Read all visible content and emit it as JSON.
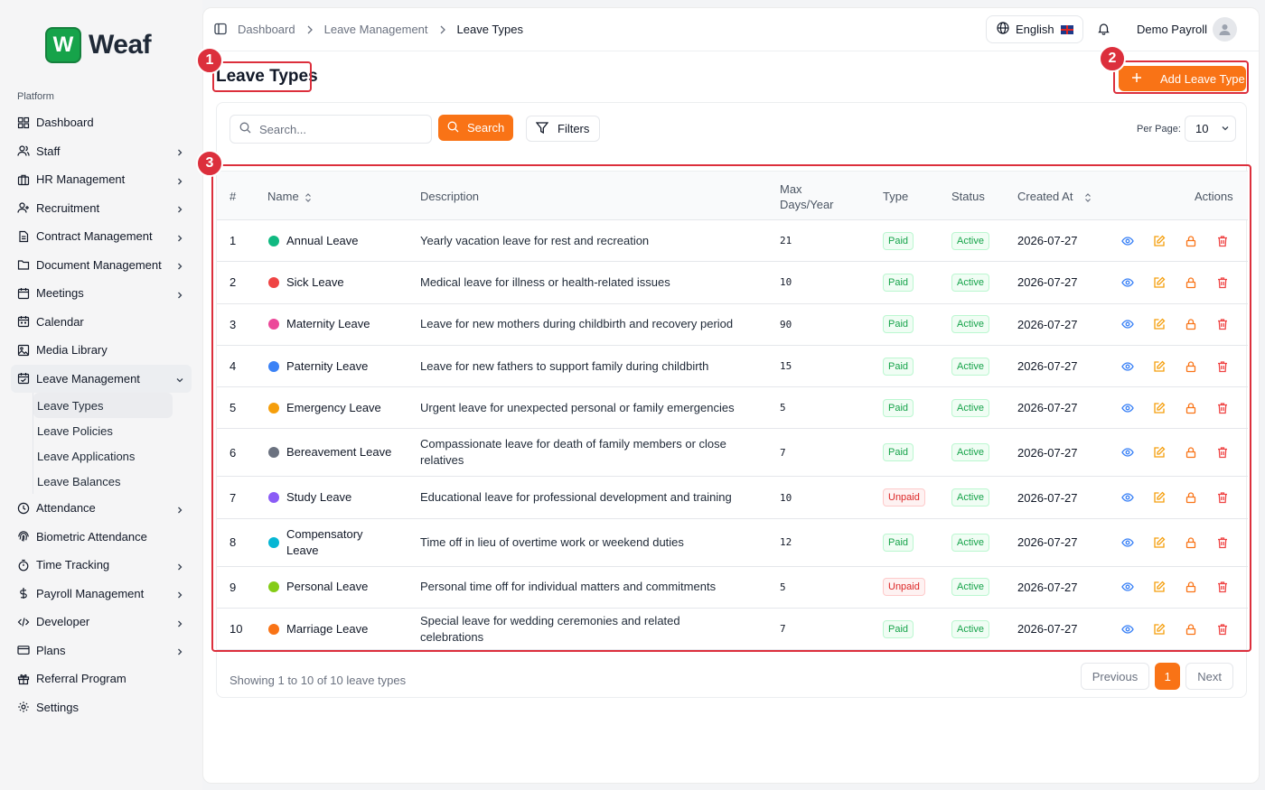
{
  "brand": {
    "logo_letter": "W",
    "name": "Weaf",
    "color": "#16a34a"
  },
  "sidebar": {
    "section_label": "Platform",
    "items": [
      {
        "label": "Dashboard",
        "icon": "grid-icon",
        "chevron": false
      },
      {
        "label": "Staff",
        "icon": "users-icon",
        "chevron": true
      },
      {
        "label": "HR Management",
        "icon": "briefcase-icon",
        "chevron": true
      },
      {
        "label": "Recruitment",
        "icon": "user-plus-icon",
        "chevron": true
      },
      {
        "label": "Contract Management",
        "icon": "file-text-icon",
        "chevron": true
      },
      {
        "label": "Document Management",
        "icon": "folder-icon",
        "chevron": true
      },
      {
        "label": "Meetings",
        "icon": "calendar-icon",
        "chevron": true
      },
      {
        "label": "Calendar",
        "icon": "calendar-days-icon",
        "chevron": false
      },
      {
        "label": "Media Library",
        "icon": "image-icon",
        "chevron": false
      },
      {
        "label": "Leave Management",
        "icon": "calendar-check-icon",
        "chevron": true,
        "open": true
      },
      {
        "label": "Attendance",
        "icon": "clock-icon",
        "chevron": true
      },
      {
        "label": "Biometric Attendance",
        "icon": "fingerprint-icon",
        "chevron": false
      },
      {
        "label": "Time Tracking",
        "icon": "timer-icon",
        "chevron": true
      },
      {
        "label": "Payroll Management",
        "icon": "dollar-icon",
        "chevron": true
      },
      {
        "label": "Developer",
        "icon": "code-icon",
        "chevron": true
      },
      {
        "label": "Plans",
        "icon": "credit-card-icon",
        "chevron": true
      },
      {
        "label": "Referral Program",
        "icon": "gift-icon",
        "chevron": false
      },
      {
        "label": "Settings",
        "icon": "gear-icon",
        "chevron": false
      }
    ],
    "leave_submenu": [
      "Leave Types",
      "Leave Policies",
      "Leave Applications",
      "Leave Balances"
    ],
    "active_sub": "Leave Types"
  },
  "topbar": {
    "breadcrumbs": [
      "Dashboard",
      "Leave Management",
      "Leave Types"
    ],
    "language": "English",
    "user_name": "Demo Payroll"
  },
  "page": {
    "title": "Leave Types",
    "add_button": "Add Leave Type",
    "accent": "#f97316",
    "callout_color": "#dc2f3c",
    "callouts": [
      "1",
      "2",
      "3"
    ]
  },
  "toolbar": {
    "search_placeholder": "Search...",
    "search_button": "Search",
    "filters_button": "Filters",
    "per_page_label": "Per Page:",
    "per_page_value": "10"
  },
  "table": {
    "headers": {
      "num": "#",
      "name": "Name",
      "description": "Description",
      "max_days": "Max Days/Year",
      "type": "Type",
      "status": "Status",
      "created": "Created At",
      "actions": "Actions"
    },
    "rows": [
      {
        "num": "1",
        "name": "Annual Leave",
        "color": "#10b981",
        "description": "Yearly vacation leave for rest and recreation",
        "max_days": "21",
        "type": "Paid",
        "status": "Active",
        "created": "2026-07-27"
      },
      {
        "num": "2",
        "name": "Sick Leave",
        "color": "#ef4444",
        "description": "Medical leave for illness or health-related issues",
        "max_days": "10",
        "type": "Paid",
        "status": "Active",
        "created": "2026-07-27"
      },
      {
        "num": "3",
        "name": "Maternity Leave",
        "color": "#ec4899",
        "description": "Leave for new mothers during childbirth and recovery period",
        "max_days": "90",
        "type": "Paid",
        "status": "Active",
        "created": "2026-07-27"
      },
      {
        "num": "4",
        "name": "Paternity Leave",
        "color": "#3b82f6",
        "description": "Leave for new fathers to support family during childbirth",
        "max_days": "15",
        "type": "Paid",
        "status": "Active",
        "created": "2026-07-27"
      },
      {
        "num": "5",
        "name": "Emergency Leave",
        "color": "#f59e0b",
        "description": "Urgent leave for unexpected personal or family emergencies",
        "max_days": "5",
        "type": "Paid",
        "status": "Active",
        "created": "2026-07-27"
      },
      {
        "num": "6",
        "name": "Bereavement Leave",
        "color": "#6b7280",
        "description": "Compassionate leave for death of family members or close relatives",
        "max_days": "7",
        "type": "Paid",
        "status": "Active",
        "created": "2026-07-27"
      },
      {
        "num": "7",
        "name": "Study Leave",
        "color": "#8b5cf6",
        "description": "Educational leave for professional development and training",
        "max_days": "10",
        "type": "Unpaid",
        "status": "Active",
        "created": "2026-07-27"
      },
      {
        "num": "8",
        "name": "Compensatory Leave",
        "color": "#06b6d4",
        "description": "Time off in lieu of overtime work or weekend duties",
        "max_days": "12",
        "type": "Paid",
        "status": "Active",
        "created": "2026-07-27"
      },
      {
        "num": "9",
        "name": "Personal Leave",
        "color": "#84cc16",
        "description": "Personal time off for individual matters and commitments",
        "max_days": "5",
        "type": "Unpaid",
        "status": "Active",
        "created": "2026-07-27"
      },
      {
        "num": "10",
        "name": "Marriage Leave",
        "color": "#f97316",
        "description": "Special leave for wedding ceremonies and related celebrations",
        "max_days": "7",
        "type": "Paid",
        "status": "Active",
        "created": "2026-07-27"
      }
    ]
  },
  "footer": {
    "showing": "Showing 1 to 10 of 10 leave types",
    "previous": "Previous",
    "page": "1",
    "next": "Next"
  }
}
